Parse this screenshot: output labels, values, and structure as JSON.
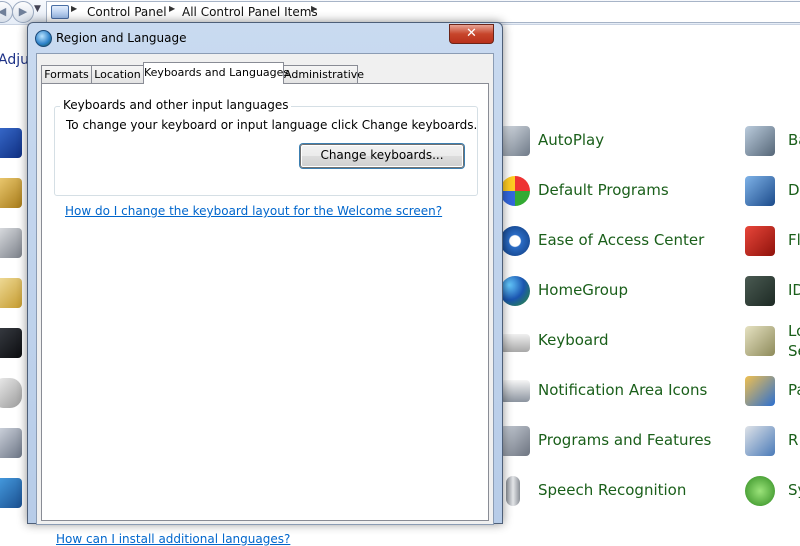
{
  "explorer": {
    "breadcrumb": [
      "Control Panel",
      "All Control Panel Items"
    ],
    "heading_partial": "Adju",
    "items_middle": [
      {
        "label": "AutoPlay",
        "icon": "autoplay-icon"
      },
      {
        "label": "Default Programs",
        "icon": "default-programs-icon"
      },
      {
        "label": "Ease of Access Center",
        "icon": "ease-of-access-icon"
      },
      {
        "label": "HomeGroup",
        "icon": "homegroup-icon"
      },
      {
        "label": "Keyboard",
        "icon": "keyboard-icon"
      },
      {
        "label": "Notification Area Icons",
        "icon": "notification-area-icon"
      },
      {
        "label": "Programs and Features",
        "icon": "programs-features-icon"
      },
      {
        "label": "Speech Recognition",
        "icon": "speech-recognition-icon"
      }
    ],
    "items_right_partial": [
      "Ba",
      "D",
      "Fl",
      "ID",
      "Lo",
      "Pa",
      "R",
      "Sy"
    ],
    "items_right_partial_line2": "Se"
  },
  "dialog": {
    "title": "Region and Language",
    "close_label": "✕",
    "tabs": [
      {
        "label": "Formats"
      },
      {
        "label": "Location"
      },
      {
        "label": "Keyboards and Languages"
      },
      {
        "label": "Administrative"
      }
    ],
    "group_title": "Keyboards and other input languages",
    "group_description": "To change your keyboard or input language click Change keyboards.",
    "change_button": "Change keyboards...",
    "welcome_link": "How do I change the keyboard layout for the Welcome screen?",
    "install_link": "How can I install additional languages?"
  }
}
